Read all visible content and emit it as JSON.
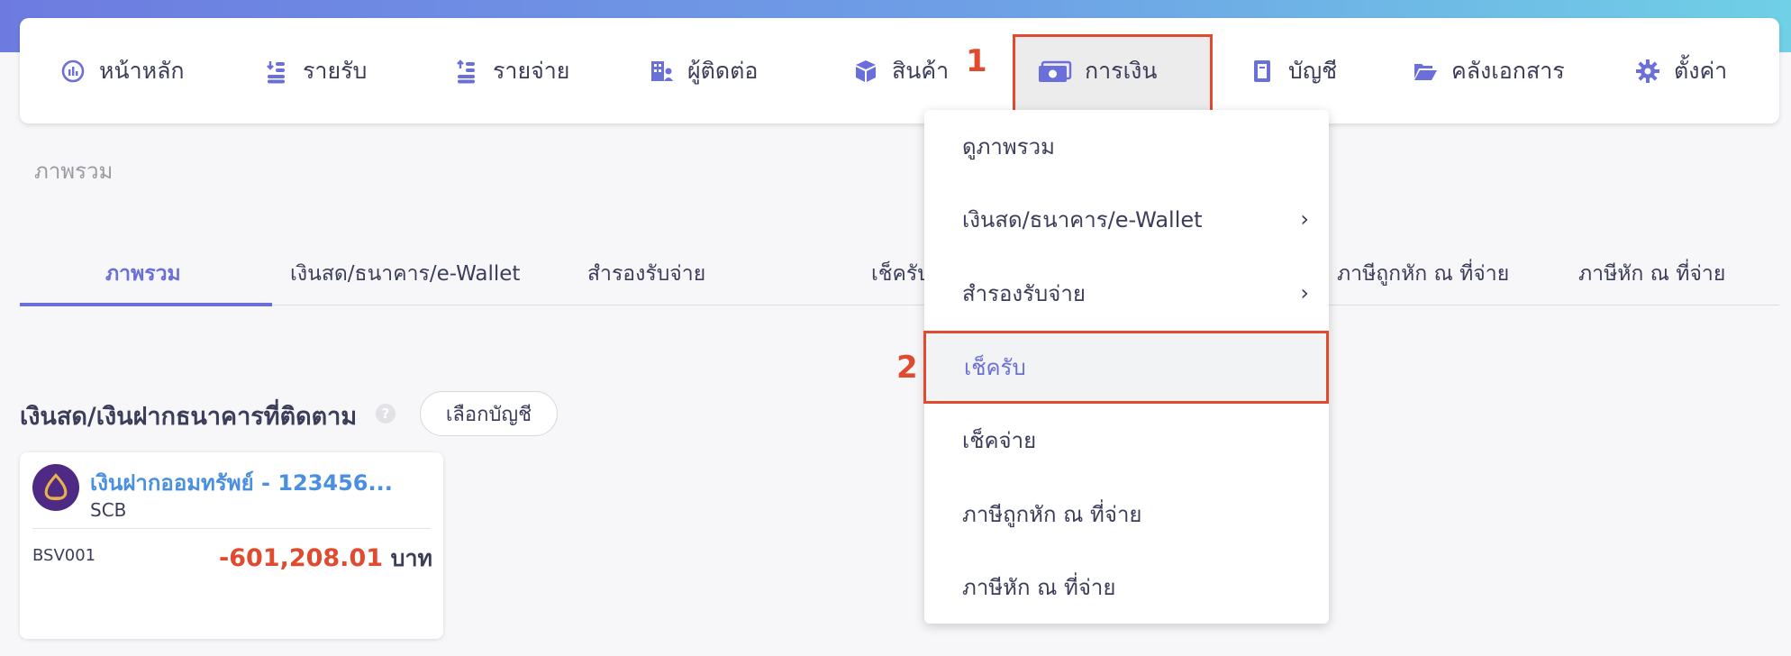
{
  "nav": {
    "items": [
      {
        "label": "หน้าหลัก",
        "icon": "dashboard-gauge-icon"
      },
      {
        "label": "รายรับ",
        "icon": "income-coins-icon"
      },
      {
        "label": "รายจ่าย",
        "icon": "expense-coins-icon"
      },
      {
        "label": "ผู้ติดต่อ",
        "icon": "contacts-building-icon"
      },
      {
        "label": "สินค้า",
        "icon": "product-box-icon"
      },
      {
        "label": "การเงิน",
        "icon": "money-bill-icon"
      },
      {
        "label": "บัญชี",
        "icon": "ledger-book-icon"
      },
      {
        "label": "คลังเอกสาร",
        "icon": "folder-open-icon"
      },
      {
        "label": "ตั้งค่า",
        "icon": "gear-icon"
      }
    ],
    "active": "การเงิน"
  },
  "annotations": {
    "step1": "1",
    "step2": "2"
  },
  "breadcrumb": "ภาพรวม",
  "tabs": [
    {
      "label": "ภาพรวม",
      "active": true
    },
    {
      "label": "เงินสด/ธนาคาร/e-Wallet"
    },
    {
      "label": "สำรองรับจ่าย"
    },
    {
      "label": "เช็ครับ"
    },
    {
      "label": "ภาษีถูกหัก ณ ที่จ่าย"
    },
    {
      "label": "ภาษีหัก ณ ที่จ่าย"
    }
  ],
  "section": {
    "title": "เงินสด/เงินฝากธนาคารที่ติดตาม",
    "help_icon": "?",
    "select_account_label": "เลือกบัญชี"
  },
  "account_card": {
    "name": "เงินฝากออมทรัพย์ - 123456...",
    "bank": "SCB",
    "code": "BSV001",
    "balance": "-601,208.01",
    "currency": "บาท"
  },
  "dropdown": {
    "items": [
      {
        "label": "ดูภาพรวม",
        "has_submenu": false
      },
      {
        "label": "เงินสด/ธนาคาร/e-Wallet",
        "has_submenu": true
      },
      {
        "label": "สำรองรับจ่าย",
        "has_submenu": true
      },
      {
        "label": "เช็ครับ",
        "has_submenu": false,
        "highlighted": true
      },
      {
        "label": "เช็คจ่าย",
        "has_submenu": false
      },
      {
        "label": "ภาษีถูกหัก ณ ที่จ่าย",
        "has_submenu": false
      },
      {
        "label": "ภาษีหัก ณ ที่จ่าย",
        "has_submenu": false
      }
    ],
    "chevron": "›"
  },
  "colors": {
    "accent": "#6b6fd8",
    "highlight_border": "#e04a2f",
    "negative": "#e04a2f",
    "link": "#4a8fe0"
  }
}
